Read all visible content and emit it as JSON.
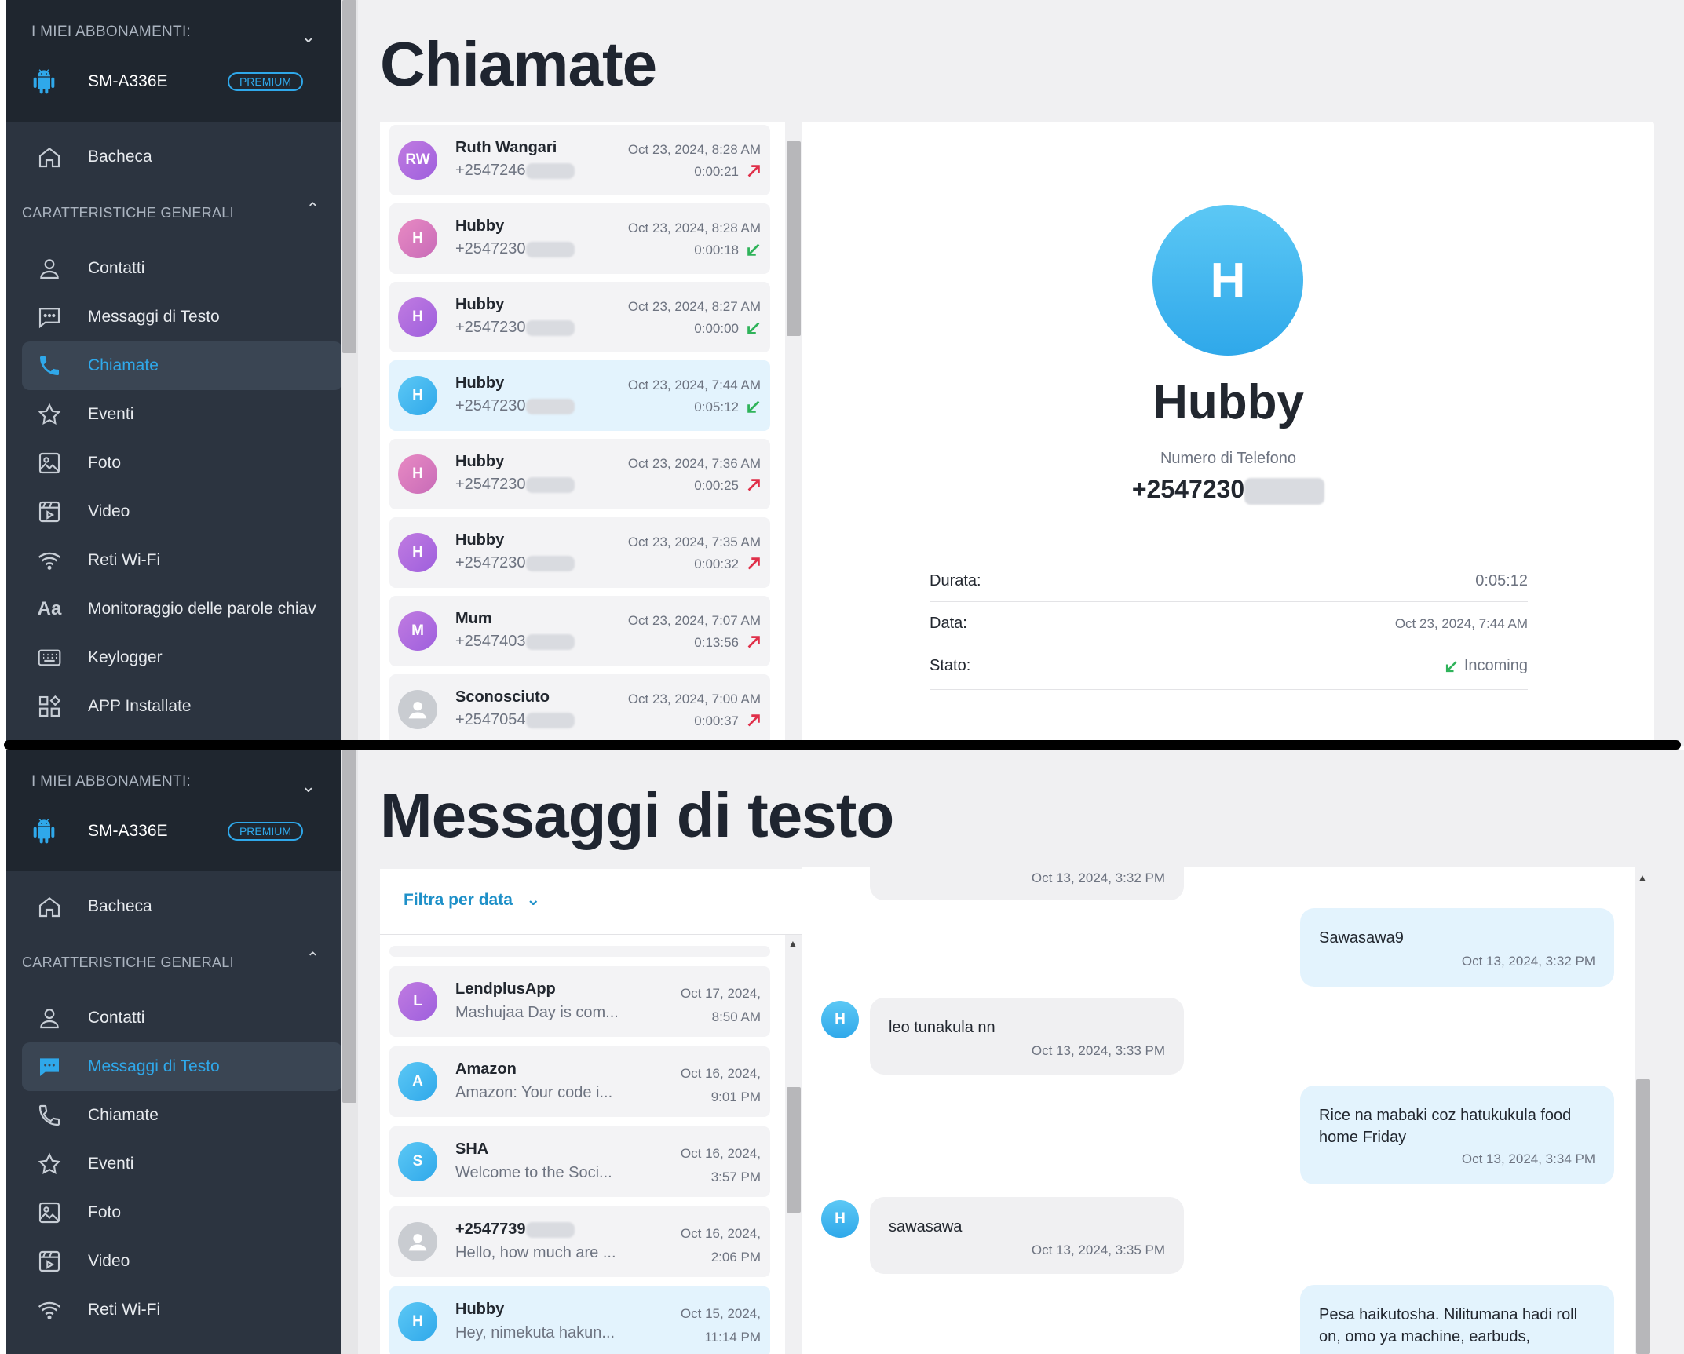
{
  "sidebar": {
    "subscriptions_label": "I MIEI ABBONAMENTI:",
    "device_name": "SM-A336E",
    "plan_badge": "PREMIUM",
    "dashboard": "Bacheca",
    "section_label": "CARATTERISTICHE GENERALI",
    "items": {
      "contacts": "Contatti",
      "sms": "Messaggi di Testo",
      "calls": "Chiamate",
      "events": "Eventi",
      "photos": "Foto",
      "videos": "Video",
      "wifi": "Reti Wi-Fi",
      "keywords": "Monitoraggio delle parole chiav",
      "keylogger": "Keylogger",
      "apps": "APP Installate"
    }
  },
  "calls_page": {
    "title": "Chiamate",
    "rows": [
      {
        "initials": "RW",
        "name": "Ruth Wangari",
        "number": "+2547246",
        "date": "Oct 23, 2024, 8:28 AM",
        "duration": "0:00:21",
        "direction": "outgoing"
      },
      {
        "initials": "H",
        "name": "Hubby",
        "number": "+2547230",
        "date": "Oct 23, 2024, 8:28 AM",
        "duration": "0:00:18",
        "direction": "incoming"
      },
      {
        "initials": "H",
        "name": "Hubby",
        "number": "+2547230",
        "date": "Oct 23, 2024, 8:27 AM",
        "duration": "0:00:00",
        "direction": "incoming"
      },
      {
        "initials": "H",
        "name": "Hubby",
        "number": "+2547230",
        "date": "Oct 23, 2024, 7:44 AM",
        "duration": "0:05:12",
        "direction": "incoming"
      },
      {
        "initials": "H",
        "name": "Hubby",
        "number": "+2547230",
        "date": "Oct 23, 2024, 7:36 AM",
        "duration": "0:00:25",
        "direction": "outgoing"
      },
      {
        "initials": "H",
        "name": "Hubby",
        "number": "+2547230",
        "date": "Oct 23, 2024, 7:35 AM",
        "duration": "0:00:32",
        "direction": "outgoing"
      },
      {
        "initials": "M",
        "name": "Mum",
        "number": "+2547403",
        "date": "Oct 23, 2024, 7:07 AM",
        "duration": "0:13:56",
        "direction": "outgoing"
      },
      {
        "initials": "",
        "name": "Sconosciuto",
        "number": "+2547054",
        "date": "Oct 23, 2024, 7:00 AM",
        "duration": "0:00:37",
        "direction": "outgoing"
      }
    ],
    "detail": {
      "initial": "H",
      "name": "Hubby",
      "phone_label": "Numero di Telefono",
      "phone": "+2547230",
      "duration_label": "Durata:",
      "duration": "0:05:12",
      "date_label": "Data:",
      "date": "Oct 23, 2024, 7:44 AM",
      "status_label": "Stato:",
      "status": "Incoming"
    }
  },
  "sms_page": {
    "title": "Messaggi di testo",
    "filter_label": "Filtra per data",
    "threads": [
      {
        "initials": "L",
        "name": "LendplusApp",
        "snippet": "Mashujaa Day is com...",
        "date": "Oct 17, 2024,",
        "time": "8:50 AM"
      },
      {
        "initials": "A",
        "name": "Amazon",
        "snippet": "Amazon: Your code i...",
        "date": "Oct 16, 2024,",
        "time": "9:01 PM"
      },
      {
        "initials": "S",
        "name": "SHA",
        "snippet": "Welcome to the Soci...",
        "date": "Oct 16, 2024,",
        "time": "3:57 PM"
      },
      {
        "initials": "",
        "name": "+2547739",
        "snippet": "Hello, how much are ...",
        "date": "Oct 16, 2024,",
        "time": "2:06 PM"
      },
      {
        "initials": "H",
        "name": "Hubby",
        "snippet": "Hey, nimekuta hakun...",
        "date": "Oct 15, 2024,",
        "time": "11:14 PM"
      }
    ],
    "messages": [
      {
        "dir": "in",
        "text": "",
        "time": "Oct 13, 2024, 3:32 PM"
      },
      {
        "dir": "out",
        "text": "Sawasawa9",
        "time": "Oct 13, 2024, 3:32 PM"
      },
      {
        "dir": "in",
        "avatar": "H",
        "text": "leo tunakula nn",
        "time": "Oct 13, 2024, 3:33 PM"
      },
      {
        "dir": "out",
        "text": "Rice na mabaki coz hatukukula food home Friday",
        "time": "Oct 13, 2024, 3:34 PM"
      },
      {
        "dir": "in",
        "avatar": "H",
        "text": "sawasawa",
        "time": "Oct 13, 2024, 3:35 PM"
      },
      {
        "dir": "out",
        "text": "Pesa haikutosha. Nilitumana hadi roll on, omo ya machine, earbuds,",
        "time": ""
      }
    ]
  },
  "colors": {
    "accent": "#2fa8ea",
    "sidebar_bg": "#2c3440",
    "incoming": "#2fb35a",
    "outgoing": "#e0304a"
  }
}
